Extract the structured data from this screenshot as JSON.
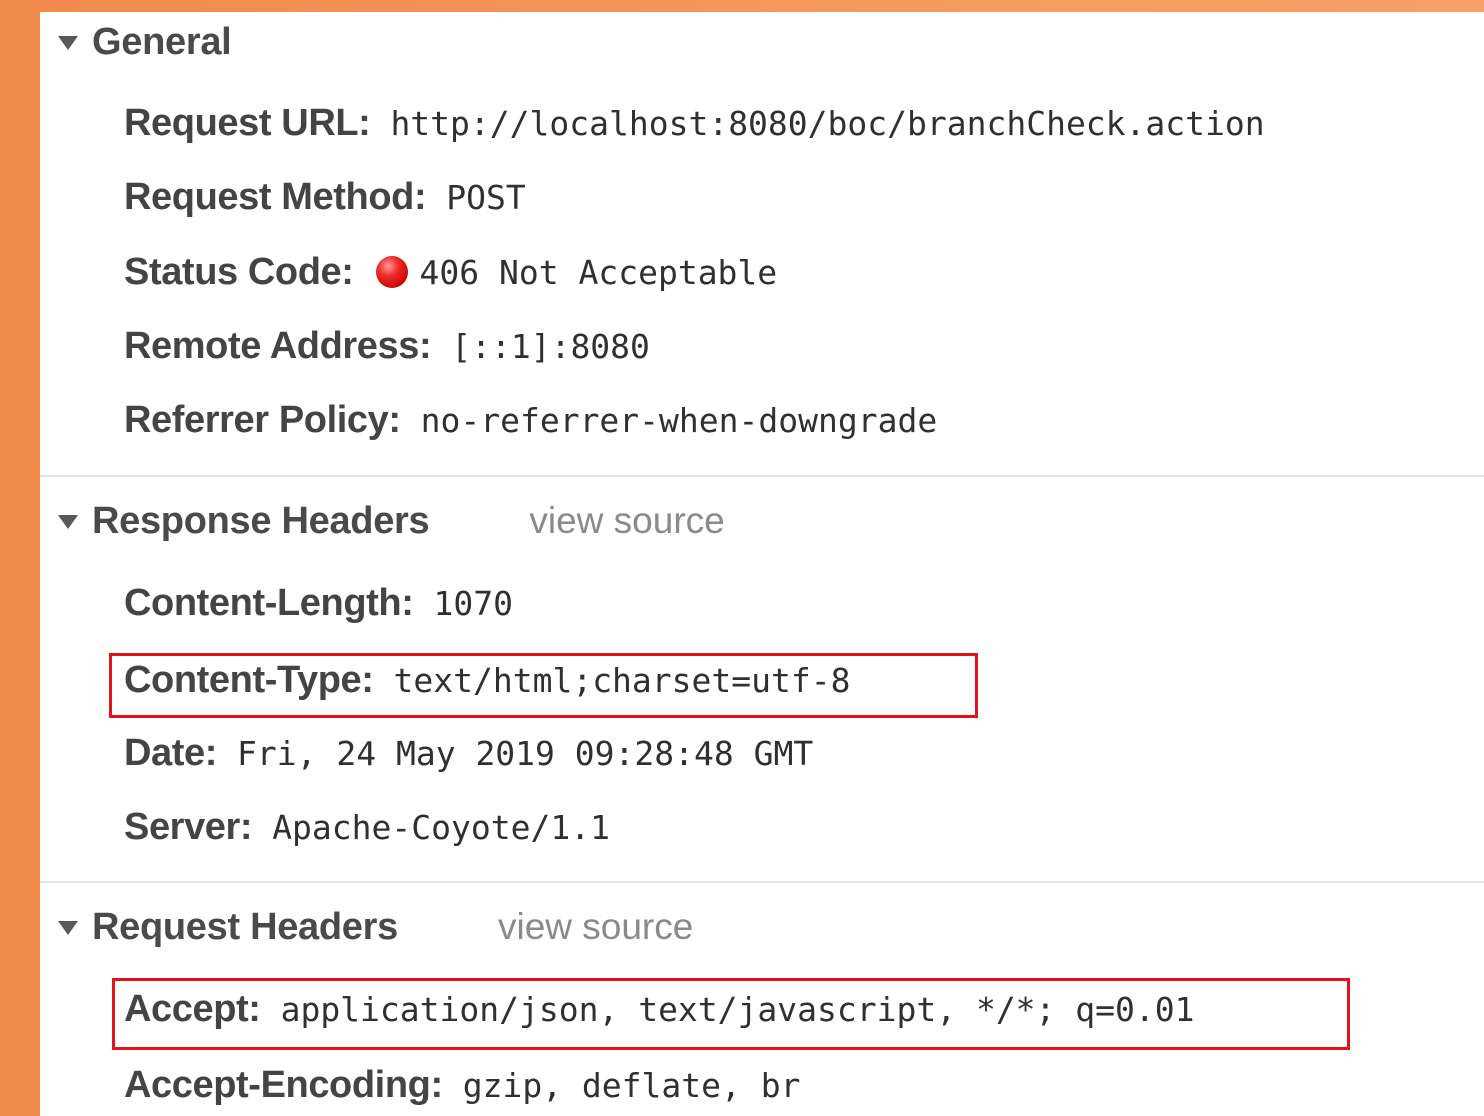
{
  "general": {
    "title": "General",
    "rows": [
      {
        "key": "Request URL:",
        "value": "http://localhost:8080/boc/branchCheck.action"
      },
      {
        "key": "Request Method:",
        "value": "POST"
      },
      {
        "key": "Status Code:",
        "value": "406 Not Acceptable"
      },
      {
        "key": "Remote Address:",
        "value": "[::1]:8080"
      },
      {
        "key": "Referrer Policy:",
        "value": "no-referrer-when-downgrade"
      }
    ],
    "status_color": "#e02020"
  },
  "response_headers": {
    "title": "Response Headers",
    "view_source": "view source",
    "rows": [
      {
        "key": "Content-Length:",
        "value": "1070"
      },
      {
        "key": "Content-Type:",
        "value": "text/html;charset=utf-8",
        "highlighted": true
      },
      {
        "key": "Date:",
        "value": "Fri, 24 May 2019 09:28:48 GMT"
      },
      {
        "key": "Server:",
        "value": "Apache-Coyote/1.1"
      }
    ]
  },
  "request_headers": {
    "title": "Request Headers",
    "view_source": "view source",
    "rows": [
      {
        "key": "Accept:",
        "value": "application/json, text/javascript, */*; q=0.01",
        "highlighted": true
      },
      {
        "key": "Accept-Encoding:",
        "value": "gzip, deflate, br"
      }
    ]
  },
  "colors": {
    "highlight_border": "#e0141e",
    "background_accent": "#f49a5e"
  }
}
